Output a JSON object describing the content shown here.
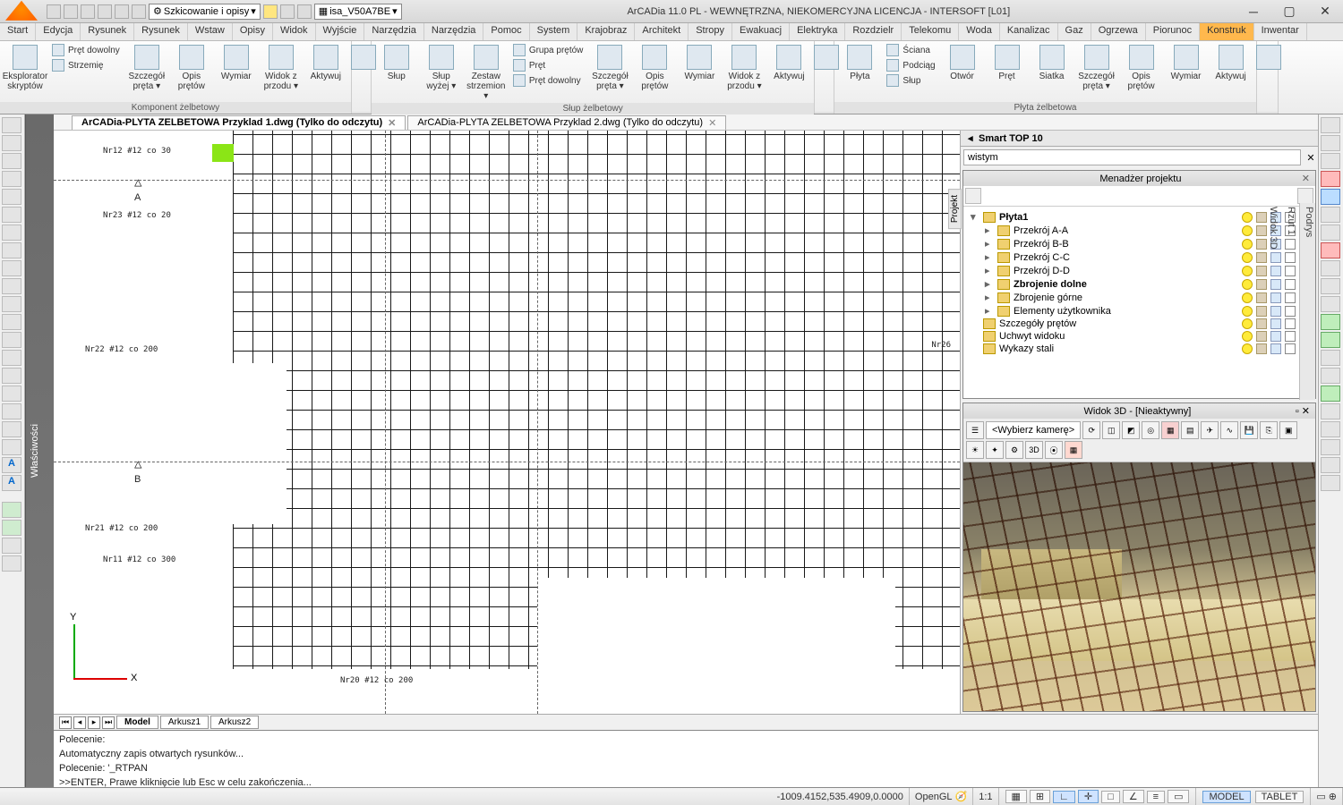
{
  "titlebar": {
    "app_title": "ArCADia 11.0 PL - WEWNĘTRZNA, NIEKOMERCYJNA LICENCJA - INTERSOFT [L01]",
    "qat_combo1": "Szkicowanie i opisy",
    "qat_combo2": "isa_V50A7BE"
  },
  "tabs": [
    "Start",
    "Edycja",
    "Rysunek",
    "Rysunek",
    "Wstaw",
    "Opisy",
    "Widok",
    "Wyjście",
    "Narzędzia",
    "Narzędzia",
    "Pomoc",
    "System",
    "Krajobraz",
    "Architekt",
    "Stropy",
    "Ewakuacj",
    "Elektryka",
    "Rozdzielr",
    "Telekomu",
    "Woda",
    "Kanalizac",
    "Gaz",
    "Ogrzewa",
    "Piorunoc",
    "Konstruk",
    "Inwentar"
  ],
  "active_tab_index": 24,
  "ribbon": {
    "groups": [
      {
        "label": "Komponent żelbetowy",
        "large": [
          {
            "label": "Eksplorator\nskryptów"
          },
          {
            "label": ""
          },
          {
            "label": "Szczegół\npręta ▾"
          },
          {
            "label": "Opis\nprętów"
          },
          {
            "label": "Wymiar"
          },
          {
            "label": "Widok z\nprzodu ▾"
          },
          {
            "label": "Aktywuj"
          }
        ],
        "small": [
          {
            "label": "Pręt dowolny"
          },
          {
            "label": "Strzemię"
          }
        ]
      },
      {
        "label": "Słup żelbetowy",
        "large": [
          {
            "label": "Słup"
          },
          {
            "label": "Słup\nwyżej ▾"
          },
          {
            "label": "Zestaw\nstrzemion ▾"
          },
          {
            "label": "Szczegół\npręta ▾"
          },
          {
            "label": "Opis\nprętów"
          },
          {
            "label": "Wymiar"
          },
          {
            "label": "Widok z\nprzodu ▾"
          },
          {
            "label": "Aktywuj"
          }
        ],
        "small": [
          {
            "label": "Grupa prętów"
          },
          {
            "label": "Pręt"
          },
          {
            "label": "Pręt dowolny"
          }
        ]
      },
      {
        "label": "Płyta żelbetowa",
        "large": [
          {
            "label": "Płyta"
          },
          {
            "label": "Otwór"
          },
          {
            "label": "Pręt"
          },
          {
            "label": "Siatka"
          },
          {
            "label": "Szczegół\npręta ▾"
          },
          {
            "label": "Opis\nprętów"
          },
          {
            "label": "Wymiar"
          },
          {
            "label": "Aktywuj"
          }
        ],
        "small": [
          {
            "label": "Ściana"
          },
          {
            "label": "Podciąg"
          },
          {
            "label": "Słup"
          }
        ]
      }
    ]
  },
  "dwg_tabs": [
    {
      "label": "ArCADia-PLYTA ZELBETOWA Przyklad 1.dwg (Tylko do odczytu)",
      "active": true
    },
    {
      "label": "ArCADia-PLYTA ZELBETOWA Przyklad 2.dwg (Tylko do odczytu)",
      "active": false
    }
  ],
  "properties_label": "Właściwości",
  "canvas": {
    "ucs_x": "X",
    "ucs_y": "Y",
    "annot1": "Nr12 #12 co 30",
    "annot2": "Nr23 #12 co 20",
    "annot3": "Nr22 #12 co 200",
    "annot4": "Nr21 #12 co 200",
    "annot5": "Nr11 #12 co 300",
    "annot6": "Nr20 #12 co 200",
    "annot7": "Nr26",
    "triA": "A",
    "triB": "B"
  },
  "smart_top": "Smart TOP 10",
  "smart_input": "wistym",
  "project_panel": {
    "title": "Menadżer projektu",
    "side_tabs": [
      "Projekt",
      "Podrys",
      "Rzut 1",
      "Widok 3D"
    ],
    "tree": [
      {
        "label": "Płyta1",
        "bold": true,
        "indent": 0
      },
      {
        "label": "Przekrój A-A",
        "indent": 1
      },
      {
        "label": "Przekrój B-B",
        "indent": 1
      },
      {
        "label": "Przekrój C-C",
        "indent": 1
      },
      {
        "label": "Przekrój D-D",
        "indent": 1
      },
      {
        "label": "Zbrojenie dolne",
        "bold": true,
        "indent": 1
      },
      {
        "label": "Zbrojenie górne",
        "indent": 1
      },
      {
        "label": "Elementy użytkownika",
        "indent": 1
      },
      {
        "label": "Szczegóły prętów",
        "indent": 0
      },
      {
        "label": "Uchwyt widoku",
        "indent": 0
      },
      {
        "label": "Wykazy stali",
        "indent": 0
      }
    ]
  },
  "view3d": {
    "title": "Widok 3D - [Nieaktywny]",
    "camera_placeholder": "<Wybierz kamerę>"
  },
  "sheet_tabs": {
    "tabs": [
      "Model",
      "Arkusz1",
      "Arkusz2"
    ]
  },
  "cmdline": {
    "line1": "Polecenie:",
    "line2": "Automatyczny zapis otwartych rysunków...",
    "line3": "Polecenie: '_RTPAN",
    "line4": ">>ENTER, Prawe kliknięcie lub Esc w celu zakończenia..."
  },
  "statusbar": {
    "coords": "-1009.4152,535.4909,0.0000",
    "render": "OpenGL",
    "scale": "1:1",
    "toggles": [
      "MODEL",
      "TABLET"
    ]
  }
}
